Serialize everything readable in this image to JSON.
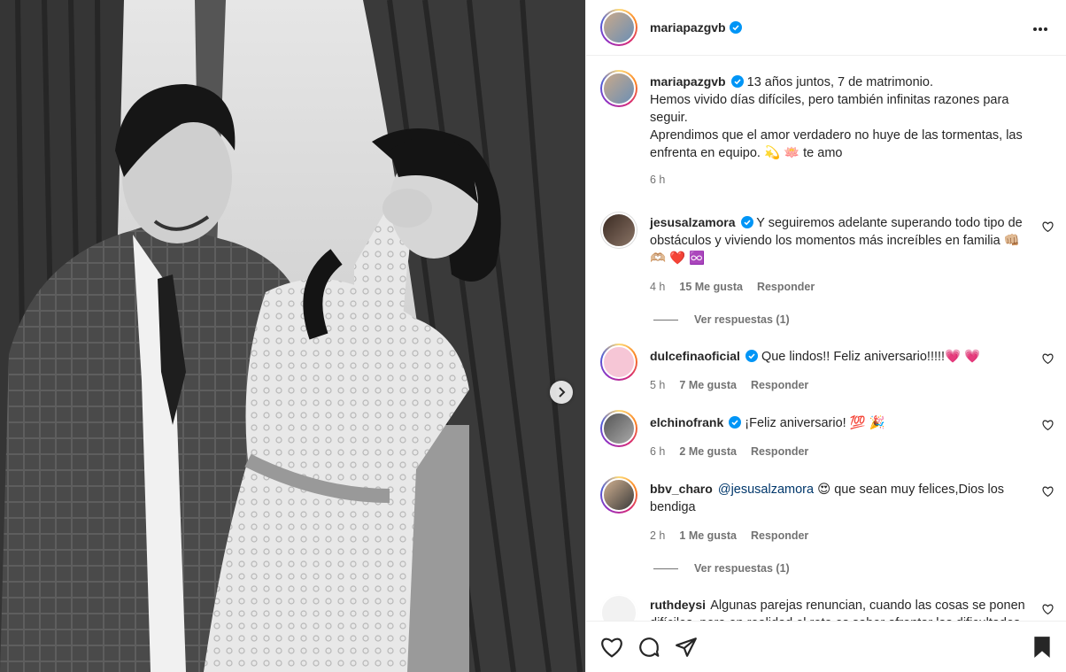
{
  "post": {
    "author": "mariapazgvb",
    "caption_lines": [
      "13 años juntos, 7 de matrimonio.",
      "Hemos vivido días difíciles, pero también infinitas razones para seguir.",
      "Aprendimos que el amor verdadero no huye de las tormentas, las enfrenta en equipo. 💫 🪷 te amo"
    ],
    "caption_time": "6 h"
  },
  "comments": [
    {
      "user": "jesusalzamora",
      "verified": true,
      "text": "Y seguiremos adelante superando todo tipo de obstáculos y viviendo los momentos más increíbles en familia 👊🏼 🫶🏼 ❤️ ♾️",
      "time": "4 h",
      "likes": "15 Me gusta",
      "reply": "Responder",
      "view_replies": "Ver respuestas (1)"
    },
    {
      "user": "dulcefinaoficial",
      "verified": true,
      "text": "Que lindos!! Feliz aniversario!!!!!💗 💗",
      "time": "5 h",
      "likes": "7 Me gusta",
      "reply": "Responder"
    },
    {
      "user": "elchinofrank",
      "verified": true,
      "text": "¡Feliz aniversario! 💯 🎉",
      "time": "6 h",
      "likes": "2 Me gusta",
      "reply": "Responder"
    },
    {
      "user": "bbv_charo",
      "verified": false,
      "mention": "@jesusalzamora",
      "text": "😍 que sean muy felices,Dios los bendiga",
      "time": "2 h",
      "likes": "1 Me gusta",
      "reply": "Responder",
      "view_replies": "Ver respuestas (1)"
    },
    {
      "user": "ruthdeysi",
      "verified": false,
      "text": "Algunas parejas renuncian, cuando las cosas se ponen difíciles, pero en realidad el reto es saber afrontar las dificultades juntos, no todo es color de rosa, pero siempre se"
    }
  ],
  "icons": {
    "verified": "verified-badge-icon",
    "more": "more-options-icon",
    "like": "heart-icon",
    "comment": "comment-icon",
    "share": "share-icon",
    "save": "bookmark-icon",
    "next": "chevron-right-icon"
  },
  "colors": {
    "verified_blue": "#0095f6",
    "text": "#262626",
    "secondary": "#737373",
    "mention": "#00376b"
  }
}
